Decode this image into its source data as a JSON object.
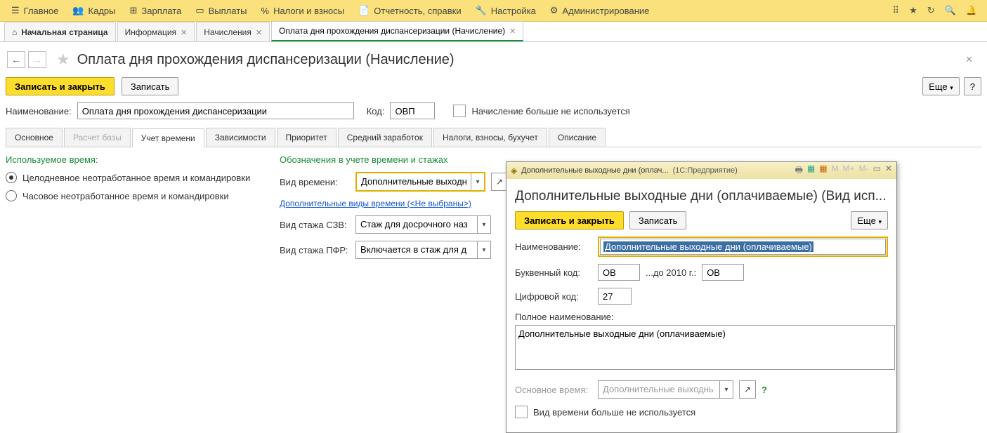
{
  "nav": {
    "items": [
      "Главное",
      "Кадры",
      "Зарплата",
      "Выплаты",
      "Налоги и взносы",
      "Отчетность, справки",
      "Настройка",
      "Администрирование"
    ]
  },
  "tabs": {
    "home": "Начальная страница",
    "items": [
      "Информация",
      "Начисления"
    ],
    "active": "Оплата дня прохождения диспансеризации (Начисление)"
  },
  "page": {
    "title": "Оплата дня прохождения диспансеризации (Начисление)"
  },
  "toolbar": {
    "save_close": "Записать и закрыть",
    "save": "Записать",
    "more": "Еще",
    "help": "?"
  },
  "form": {
    "name_label": "Наименование:",
    "name_value": "Оплата дня прохождения диспансеризации",
    "code_label": "Код:",
    "code_value": "ОВП",
    "unused_label": "Начисление больше не используется"
  },
  "subtabs": [
    "Основное",
    "Расчет базы",
    "Учет времени",
    "Зависимости",
    "Приоритет",
    "Средний заработок",
    "Налоги, взносы, бухучет",
    "Описание"
  ],
  "left": {
    "title": "Используемое время:",
    "r1": "Целодневное неотработанное время и командировки",
    "r2": "Часовое неотработанное время и командировки"
  },
  "right": {
    "title": "Обозначения в учете времени и стажах",
    "time_type_label": "Вид времени:",
    "time_type_value": "Дополнительные выходны",
    "extra_link": "Дополнительные виды времени (<Не выбраны>)",
    "szv_label": "Вид стажа СЗВ:",
    "szv_value": "Стаж для досрочного наз",
    "pfr_label": "Вид стажа ПФР:",
    "pfr_value": "Включается в стаж для д"
  },
  "popup": {
    "wintitle": "Дополнительные выходные дни (оплач...",
    "winsub": "(1С:Предприятие)",
    "title": "Дополнительные выходные дни (оплачиваемые) (Вид исп...",
    "save_close": "Записать и закрыть",
    "save": "Записать",
    "more": "Еще",
    "name_label": "Наименование:",
    "name_value": "Дополнительные выходные дни (оплачиваемые)",
    "letter_label": "Буквенный код:",
    "letter_value": "ОВ",
    "until_label": "...до 2010 г.:",
    "until_value": "ОВ",
    "digit_label": "Цифровой код:",
    "digit_value": "27",
    "full_label": "Полное наименование:",
    "full_value": "Дополнительные выходные дни (оплачиваемые)",
    "base_label": "Основное время:",
    "base_value": "Дополнительные выходнь",
    "unused": "Вид времени больше не используется"
  }
}
